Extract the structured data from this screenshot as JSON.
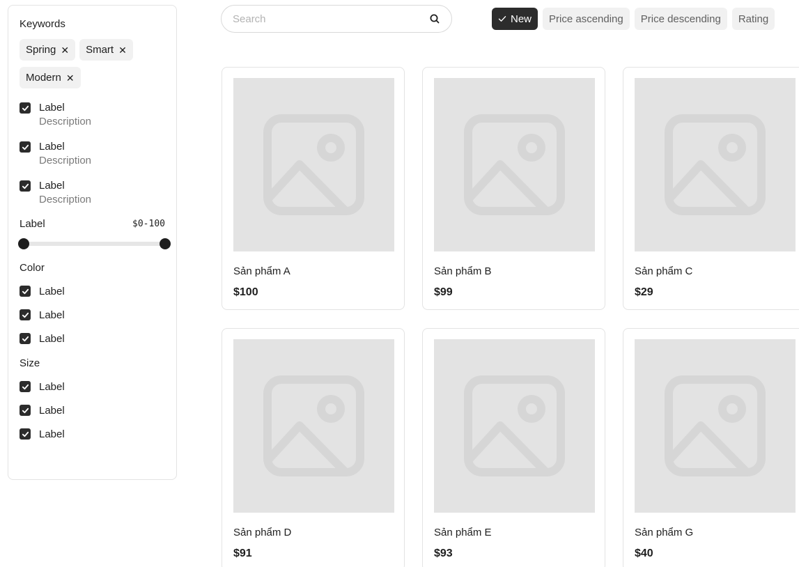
{
  "filters": {
    "keywords_title": "Keywords",
    "keywords": [
      "Spring",
      "Smart",
      "Modern"
    ],
    "checkboxes": [
      {
        "label": "Label",
        "description": "Description",
        "checked": true
      },
      {
        "label": "Label",
        "description": "Description",
        "checked": true
      },
      {
        "label": "Label",
        "description": "Description",
        "checked": true
      }
    ],
    "range": {
      "label": "Label",
      "value_text": "$0-100",
      "min": 0,
      "max": 100
    },
    "color": {
      "title": "Color",
      "options": [
        "Label",
        "Label",
        "Label"
      ]
    },
    "size": {
      "title": "Size",
      "options": [
        "Label",
        "Label",
        "Label"
      ]
    }
  },
  "search": {
    "placeholder": "Search",
    "icon": "search-icon"
  },
  "sort_chips": [
    {
      "label": "New",
      "active": true,
      "icon": "check-icon"
    },
    {
      "label": "Price ascending",
      "active": false
    },
    {
      "label": "Price descending",
      "active": false
    },
    {
      "label": "Rating",
      "active": false
    }
  ],
  "products": [
    {
      "name": "Sản phẩm A",
      "price": "$100"
    },
    {
      "name": "Sản phẩm B",
      "price": "$99"
    },
    {
      "name": "Sản phẩm C",
      "price": "$29"
    },
    {
      "name": "Sản phẩm D",
      "price": "$91"
    },
    {
      "name": "Sản phẩm E",
      "price": "$93"
    },
    {
      "name": "Sản phẩm G",
      "price": "$40"
    }
  ],
  "colors": {
    "accent": "#2c2c2c",
    "image_placeholder": "#e3e3e3",
    "chip_bg": "#f1f1f1"
  }
}
